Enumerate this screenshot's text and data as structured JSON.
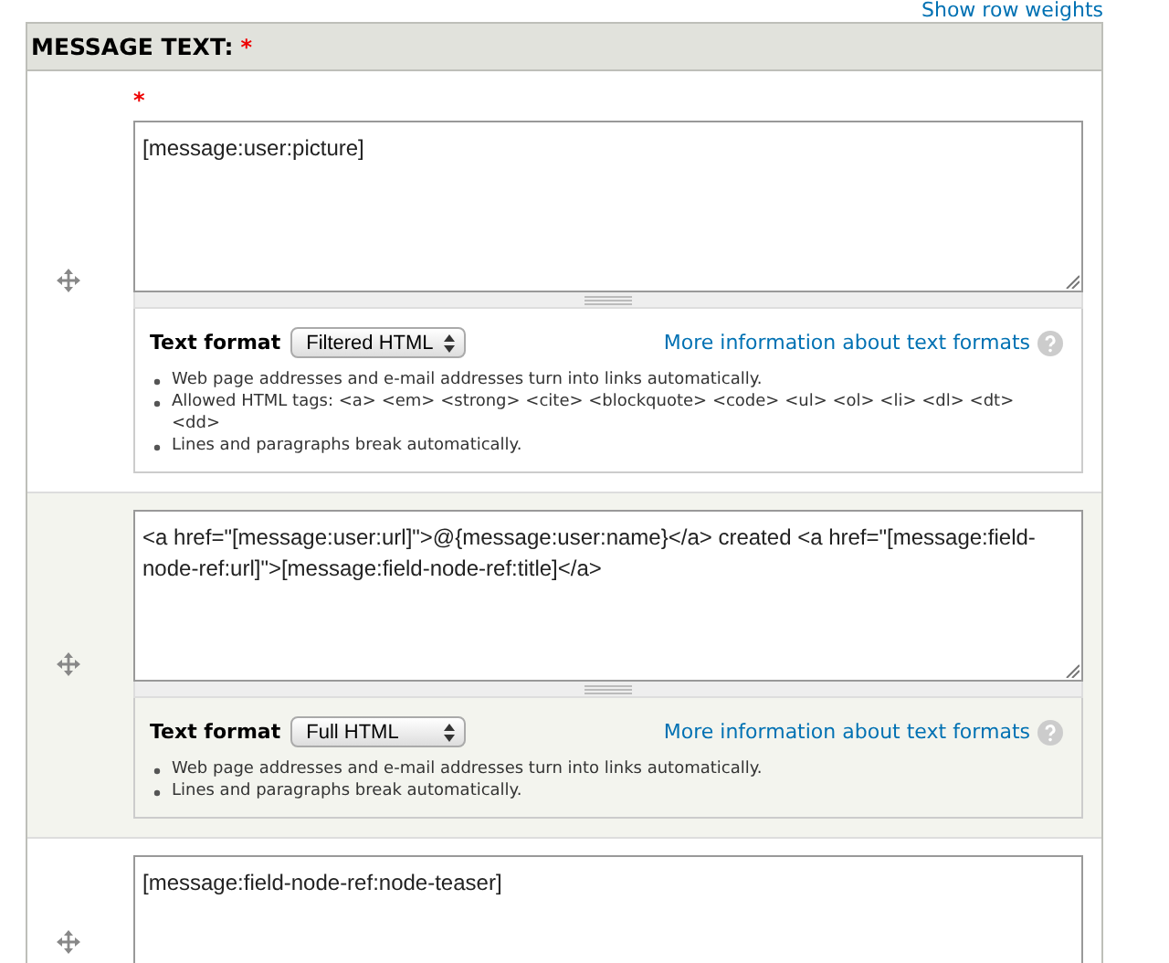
{
  "top_link": "Show row weights",
  "field": {
    "label": "MESSAGE TEXT:",
    "required_mark": "*"
  },
  "rows": [
    {
      "required_mark": "*",
      "value": "[message:user:picture]",
      "format": {
        "label": "Text format",
        "selected": "Filtered HTML",
        "more_link": "More information about text formats",
        "tips": [
          "Web page addresses and e-mail addresses turn into links automatically.",
          "Allowed HTML tags: <a> <em> <strong> <cite> <blockquote> <code> <ul> <ol> <li> <dl> <dt> <dd>",
          "Lines and paragraphs break automatically."
        ]
      }
    },
    {
      "value": "<a href=\"[message:user:url]\">@{message:user:name}</a> created <a href=\"[message:field-node-ref:url]\">[message:field-node-ref:title]</a>",
      "format": {
        "label": "Text format",
        "selected": "Full HTML",
        "more_link": "More information about text formats",
        "tips": [
          "Web page addresses and e-mail addresses turn into links automatically.",
          "Lines and paragraphs break automatically."
        ]
      }
    },
    {
      "value": "[message:field-node-ref:node-teaser]"
    }
  ]
}
